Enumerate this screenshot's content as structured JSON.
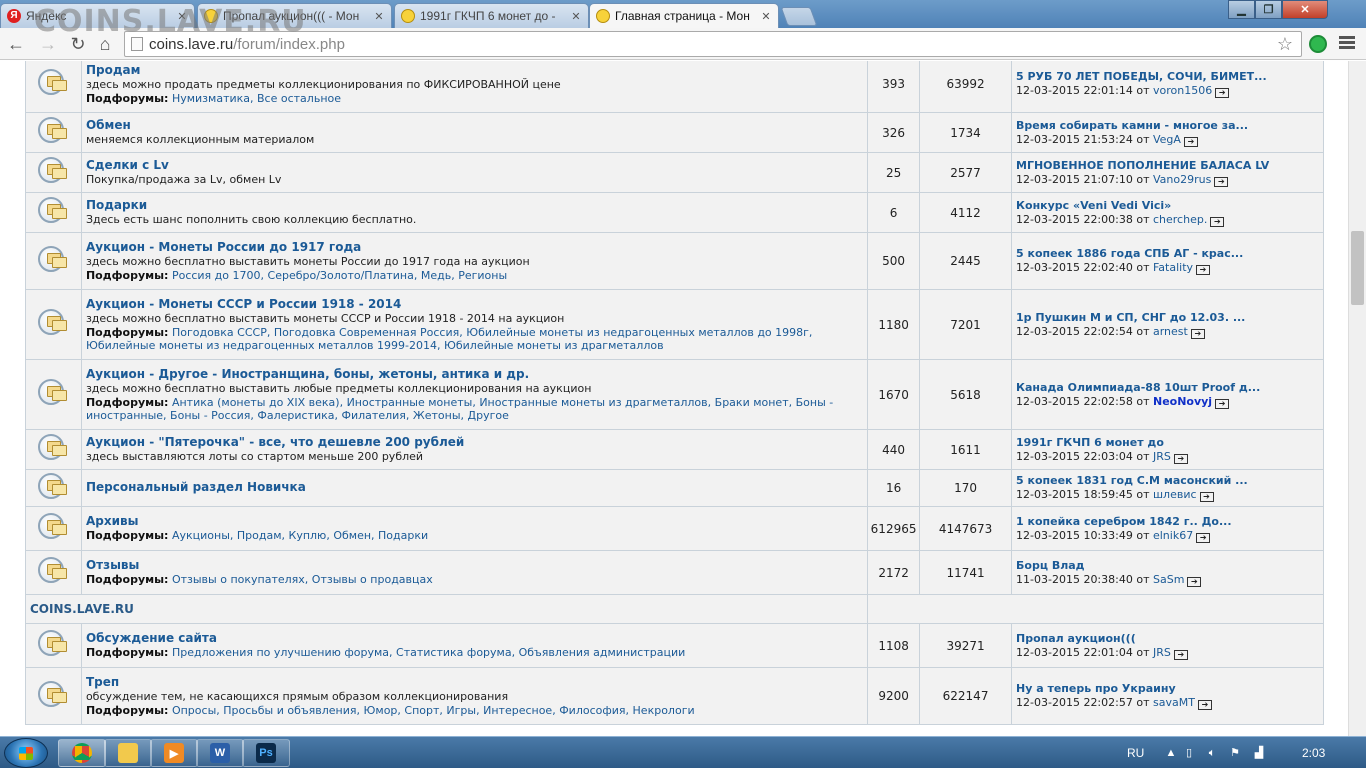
{
  "browser": {
    "tabs": [
      {
        "title": "Яндекс",
        "icon": "yandex-icon"
      },
      {
        "title": "Пропал аукцион((( - Мон",
        "icon": "smiley-icon"
      },
      {
        "title": "1991г ГКЧП 6 монет до - ",
        "icon": "smiley-icon"
      },
      {
        "title": "Главная страница - Мон",
        "icon": "smiley-icon",
        "active": true
      }
    ],
    "url_host": "coins.lave.ru",
    "url_path": "/forum/index.php",
    "watermark": "COINS.LAVE.RU"
  },
  "forums": [
    {
      "title": "Продам",
      "desc": "здесь можно продать предметы коллекционирования по ФИКСИРОВАННОЙ цене",
      "subforums_label": "Подфорумы:",
      "subforums": [
        "Нумизматика",
        "Все остальное"
      ],
      "topics": "393",
      "posts": "63992",
      "last_title": "5 РУБ 70 ЛЕТ ПОБЕДЫ, СОЧИ, БИМЕТ...",
      "last_date": "12-03-2015 22:01:14",
      "last_by": "от",
      "last_user": "voron1506"
    },
    {
      "title": "Обмен",
      "desc": "меняемся коллекционным материалом",
      "topics": "326",
      "posts": "1734",
      "last_title": "Время собирать камни - многое за...",
      "last_date": "12-03-2015 21:53:24",
      "last_by": "от",
      "last_user": "VegA"
    },
    {
      "title": "Сделки с Lv",
      "desc": "Покупка/продажа за Lv, обмен Lv",
      "topics": "25",
      "posts": "2577",
      "last_title": "МГНОВЕННОЕ ПОПОЛНЕНИЕ БАЛАСА LV",
      "last_date": "12-03-2015 21:07:10",
      "last_by": "от",
      "last_user": "Vano29rus"
    },
    {
      "title": "Подарки",
      "desc": "Здесь есть шанс пополнить свою коллекцию бесплатно.",
      "topics": "6",
      "posts": "4112",
      "last_title": "Конкурс «Veni Vedi Vici»",
      "last_date": "12-03-2015 22:00:38",
      "last_by": "от",
      "last_user": "cherchep."
    },
    {
      "title": "Аукцион - Монеты России до 1917 года",
      "desc": "здесь можно бесплатно выставить монеты России до 1917 года на аукцион",
      "subforums_label": "Подфорумы:",
      "subforums": [
        "Россия до 1700",
        "Серебро/Золото/Платина",
        "Медь",
        "Регионы"
      ],
      "topics": "500",
      "posts": "2445",
      "last_title": "5 копеек 1886 года СПБ АГ - крас...",
      "last_date": "12-03-2015 22:02:40",
      "last_by": "от",
      "last_user": "Fatality"
    },
    {
      "title": "Аукцион - Монеты СССР и России 1918 - 2014",
      "desc": "здесь можно бесплатно выставить монеты СССР и России 1918 - 2014 на аукцион",
      "subforums_label": "Подфорумы:",
      "subforums": [
        "Погодовка СССР",
        "Погодовка Современная Россия",
        "Юбилейные монеты из недрагоценных металлов до 1998г",
        "Юбилейные монеты из недрагоценных металлов 1999-2014",
        "Юбилейные монеты из драгметаллов"
      ],
      "topics": "1180",
      "posts": "7201",
      "last_title": "1р Пушкин М и СП, СНГ до 12.03. ...",
      "last_date": "12-03-2015 22:02:54",
      "last_by": "от",
      "last_user": "arnest"
    },
    {
      "title": "Аукцион - Другое - Иностранщина, боны, жетоны, антика и др.",
      "desc": "здесь можно бесплатно выставить любые предметы коллекционирования на аукцион",
      "subforums_label": "Подфорумы:",
      "subforums": [
        "Антика (монеты до XIX века)",
        "Иностранные монеты",
        "Иностранные монеты из драгметаллов",
        "Браки монет",
        "Боны - иностранные",
        "Боны - Россия",
        "Фалеристика",
        "Филателия",
        "Жетоны",
        "Другое"
      ],
      "topics": "1670",
      "posts": "5618",
      "last_title": "Канада Олимпиада-88 10шт Proof д...",
      "last_date": "12-03-2015 22:02:58",
      "last_by": "от",
      "last_user": "NeoNovyj",
      "last_user_strong": true
    },
    {
      "title": "Аукцион - \"Пятерочка\" - все, что дешевле 200 рублей",
      "desc": "здесь выставляются лоты со стартом меньше 200 рублей",
      "topics": "440",
      "posts": "1611",
      "last_title": "1991г ГКЧП 6 монет до",
      "last_date": "12-03-2015 22:03:04",
      "last_by": "от",
      "last_user": "JRS"
    },
    {
      "title": "Персональный раздел Новичка",
      "desc": "",
      "topics": "16",
      "posts": "170",
      "last_title": "5 копеек 1831 год С.М масонский ...",
      "last_date": "12-03-2015 18:59:45",
      "last_by": "от",
      "last_user": "шлевис"
    },
    {
      "title": "Архивы",
      "desc": "",
      "subforums_label": "Подфорумы:",
      "subforums": [
        "Аукционы",
        "Продам",
        "Куплю",
        "Обмен",
        "Подарки"
      ],
      "topics": "612965",
      "posts": "4147673",
      "last_title": "1 копейка серебром 1842 г.. До...",
      "last_date": "12-03-2015 10:33:49",
      "last_by": "от",
      "last_user": "elnik67"
    },
    {
      "title": "Отзывы",
      "desc": "",
      "subforums_label": "Подфорумы:",
      "subforums": [
        "Отзывы о покупателях",
        "Отзывы о продавцах"
      ],
      "topics": "2172",
      "posts": "11741",
      "last_title": "Борц Влад",
      "last_date": "11-03-2015 20:38:40",
      "last_by": "от",
      "last_user": "SaSm"
    }
  ],
  "category": {
    "title": "COINS.LAVE.RU"
  },
  "forums2": [
    {
      "title": "Обсуждение сайта",
      "desc": "",
      "subforums_label": "Подфорумы:",
      "subforums": [
        "Предложения по улучшению форума",
        "Статистика форума",
        "Объявления администрации"
      ],
      "topics": "1108",
      "posts": "39271",
      "last_title": "Пропал аукцион(((",
      "last_date": "12-03-2015 22:01:04",
      "last_by": "от",
      "last_user": "JRS"
    },
    {
      "title": "Треп",
      "desc": "обсуждение тем, не касающихся прямым образом коллекционирования",
      "subforums_label": "Подфорумы:",
      "subforums": [
        "Опросы",
        "Просьбы и объявления",
        "Юмор",
        "Спорт",
        "Игры",
        "Интересное",
        "Философия",
        "Некрологи"
      ],
      "topics": "9200",
      "posts": "622147",
      "last_title": "Ну а теперь про Украину",
      "last_date": "12-03-2015 22:02:57",
      "last_by": "от",
      "last_user": "savaMT"
    }
  ],
  "taskbar": {
    "apps": [
      "chrome",
      "explorer",
      "media-player",
      "word",
      "photoshop"
    ],
    "word_label": "W",
    "ps_label": "Ps",
    "lang": "RU",
    "time": "2:03"
  }
}
